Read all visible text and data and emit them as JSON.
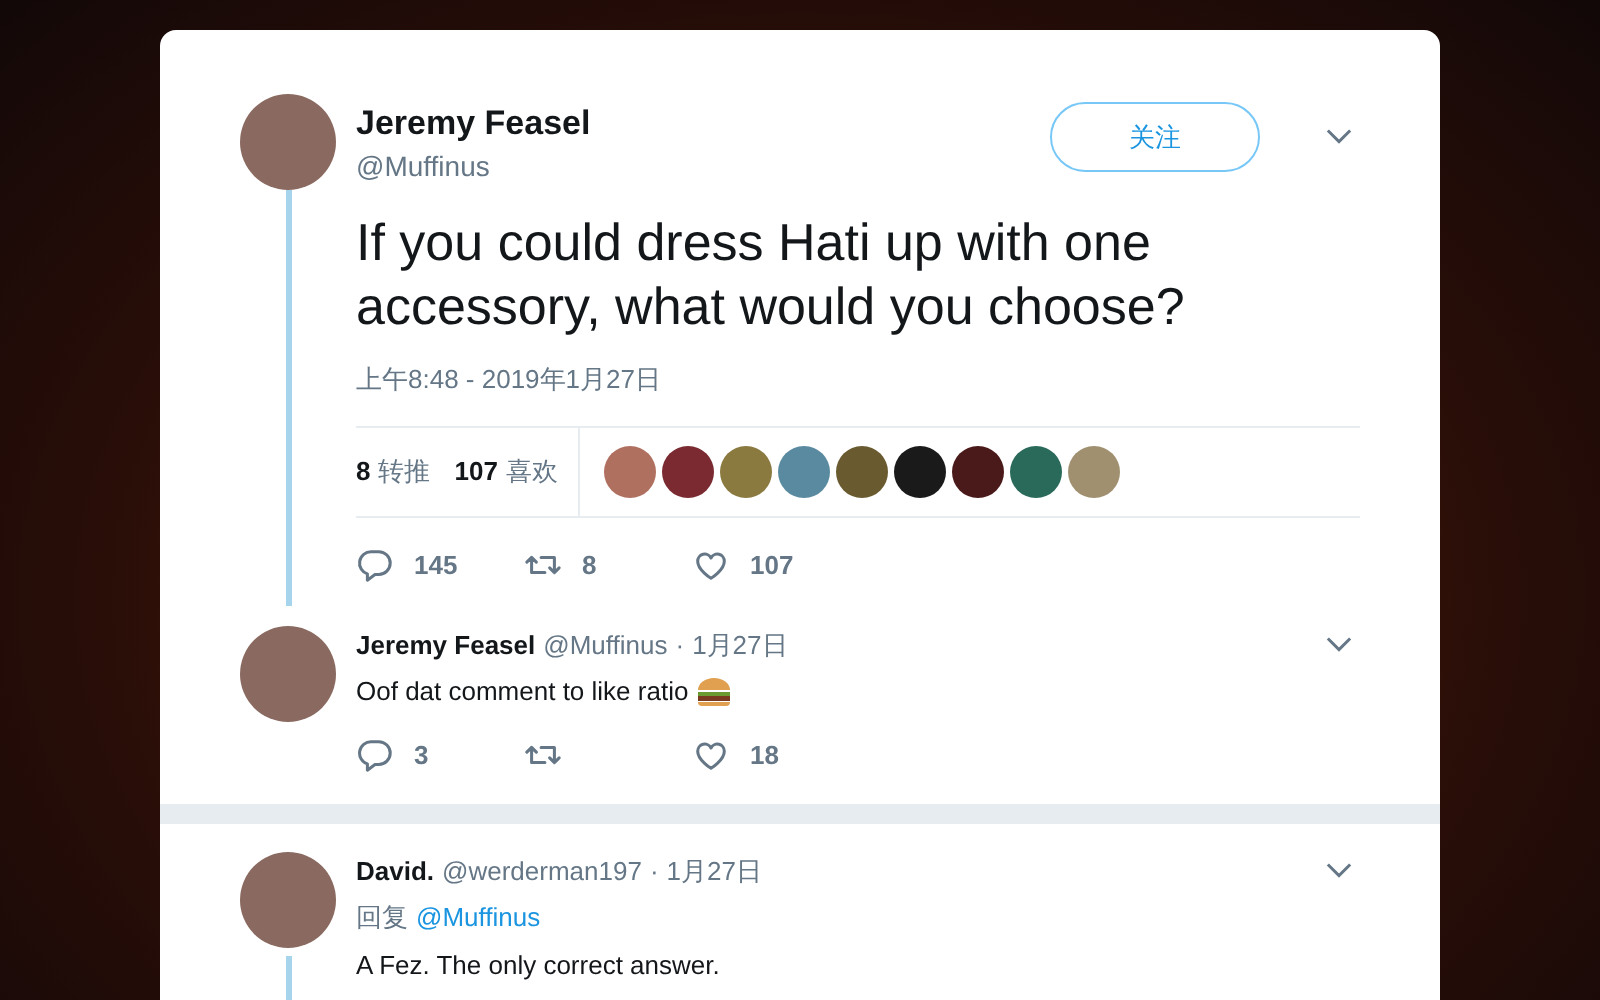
{
  "tweet": {
    "author": {
      "name": "Jeremy Feasel",
      "handle": "@Muffinus"
    },
    "follow_button": "关注",
    "text": "If you could dress Hati up with one accessory, what would you choose?",
    "timestamp": "上午8:48 - 2019年1月27日",
    "stats": [
      {
        "count": "8",
        "label": "转推"
      },
      {
        "count": "107",
        "label": "喜欢"
      }
    ],
    "liker_avatars": [
      {
        "color": "#b07060"
      },
      {
        "color": "#7a2a30"
      },
      {
        "color": "#8a7a40"
      },
      {
        "color": "#5a8aa0"
      },
      {
        "color": "#6a5a30"
      },
      {
        "color": "#1a1a1a"
      },
      {
        "color": "#4a1a1a"
      },
      {
        "color": "#2a6a5a"
      },
      {
        "color": "#a09070"
      }
    ],
    "actions": [
      {
        "kind": "reply",
        "count": "145"
      },
      {
        "kind": "retweet",
        "count": "8"
      },
      {
        "kind": "like",
        "count": "107"
      }
    ]
  },
  "replies": [
    {
      "author": {
        "name": "Jeremy Feasel",
        "handle": "@Muffinus"
      },
      "separator": "·",
      "date": "1月27日",
      "text": "Oof dat comment to like ratio",
      "burger": true,
      "actions": [
        {
          "kind": "reply",
          "count": "3"
        },
        {
          "kind": "retweet"
        },
        {
          "kind": "like",
          "count": "18"
        }
      ]
    },
    {
      "author": {
        "name": "David.",
        "handle": "@werderman197"
      },
      "separator": "·",
      "date": "1月27日",
      "reply_to": {
        "prefix": "回复",
        "handle": "@Muffinus"
      },
      "text": "A Fez. The only correct answer."
    }
  ]
}
